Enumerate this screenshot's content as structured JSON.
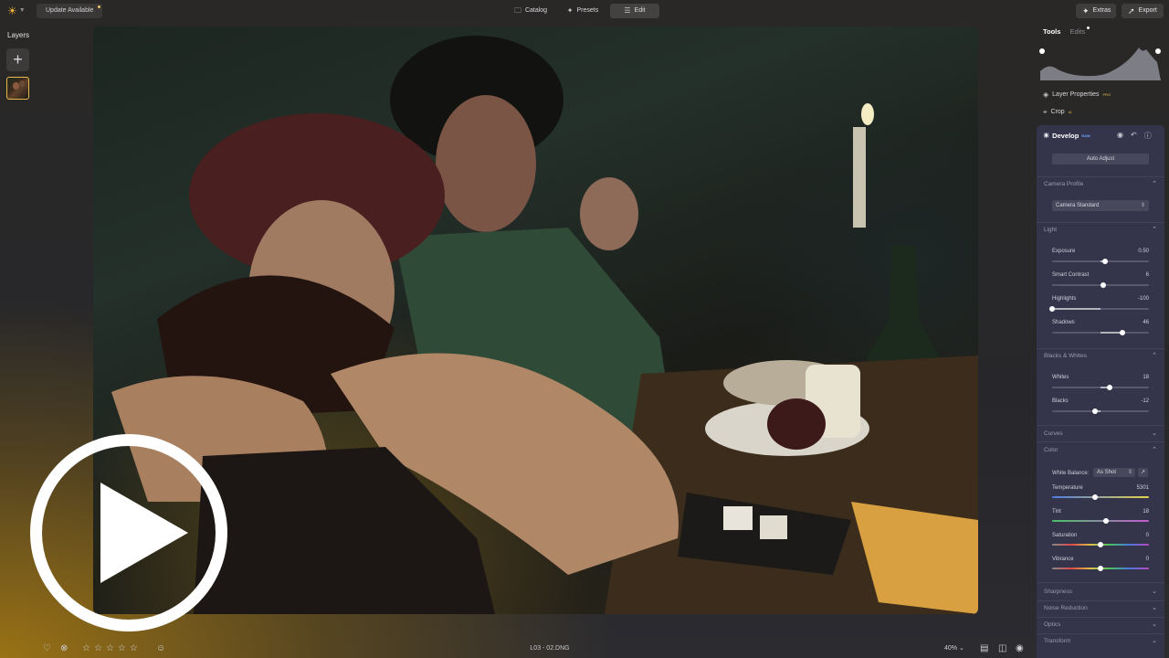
{
  "topbar": {
    "update_label": "Update Available",
    "modes": {
      "catalog": "Catalog",
      "presets": "Presets",
      "edit": "Edit"
    },
    "extras_label": "Extras",
    "export_label": "Export"
  },
  "layers": {
    "title": "Layers"
  },
  "bottombar": {
    "filename": "L03 - 02.DNG",
    "zoom": "40% ⌄",
    "rating": 0
  },
  "right_panel": {
    "tabs": {
      "tools": "Tools",
      "edits": "Edits"
    },
    "layer_properties": "Layer Properties",
    "layer_properties_badge": "PRO",
    "crop": "Crop",
    "crop_badge": "AI",
    "develop": {
      "title": "Develop",
      "badge": "RAW",
      "auto_adjust": "Auto Adjust",
      "sections": {
        "camera_profile": "Camera Profile",
        "light": "Light",
        "blacks_whites": "Blacks & Whites",
        "curves": "Curves",
        "color": "Color",
        "sharpness": "Sharpness",
        "noise_reduction": "Noise Reduction",
        "optics": "Optics",
        "transform": "Transform"
      },
      "camera_profile_value": "Camera Standard",
      "sliders": {
        "exposure": {
          "label": "Exposure",
          "value": "0.50",
          "pos": 0.55
        },
        "smart_contrast": {
          "label": "Smart Contrast",
          "value": "6",
          "pos": 0.53
        },
        "highlights": {
          "label": "Highlights",
          "value": "-100",
          "pos": 0.0
        },
        "shadows": {
          "label": "Shadows",
          "value": "46",
          "pos": 0.73
        },
        "whites": {
          "label": "Whites",
          "value": "18",
          "pos": 0.59
        },
        "blacks": {
          "label": "Blacks",
          "value": "-12",
          "pos": 0.44
        },
        "temperature": {
          "label": "Temperature",
          "value": "5301",
          "pos": 0.44
        },
        "tint": {
          "label": "Tint",
          "value": "18",
          "pos": 0.56
        },
        "saturation": {
          "label": "Saturation",
          "value": "0",
          "pos": 0.5
        },
        "vibrance": {
          "label": "Vibrance",
          "value": "0",
          "pos": 0.5
        }
      },
      "white_balance_label": "White Balance:",
      "white_balance_value": "As Shot"
    }
  },
  "colors": {
    "accent": "#f0b33a",
    "panel": "#34344a",
    "selected_layer_border": "#e7b84a"
  }
}
